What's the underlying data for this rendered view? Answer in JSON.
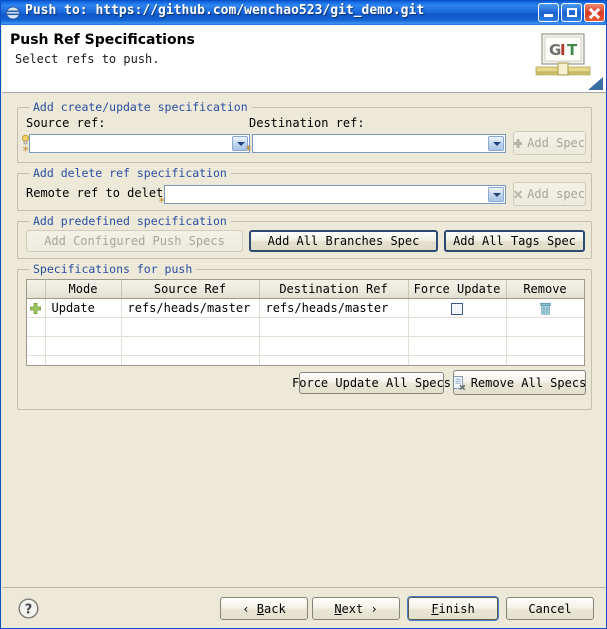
{
  "window": {
    "title": "Push to: https://github.com/wenchao523/git_demo.git",
    "app_icon": "git-window-icon",
    "minimize_label": "Minimize",
    "maximize_label": "Maximize",
    "close_label": "Close"
  },
  "header": {
    "title": "Push Ref Specifications",
    "subtitle": "Select refs to push.",
    "logo_text": "GIT",
    "logo_letters": [
      "G",
      "I",
      "T"
    ]
  },
  "create_update_group": {
    "legend": "Add create/update specification",
    "source_label": "Source ref:",
    "source_value": "",
    "source_decoration": "*",
    "source_hint_icon": "lightbulb-icon",
    "destination_label": "Destination ref:",
    "destination_value": "",
    "destination_decoration": "*",
    "add_spec_label": "Add Spec",
    "add_spec_icon": "plus-icon",
    "add_spec_enabled": false
  },
  "delete_group": {
    "legend": "Add delete ref specification",
    "remote_label": "Remote ref to delete:",
    "remote_value": "",
    "remote_decoration": "*",
    "add_spec_label": "Add spec",
    "add_spec_icon": "x-mark-icon",
    "add_spec_enabled": false
  },
  "predefined_group": {
    "legend": "Add predefined specification",
    "add_configured_label": "Add Configured Push Specs",
    "add_configured_enabled": false,
    "add_all_branches_label": "Add All Branches Spec",
    "add_all_tags_label": "Add All Tags Spec"
  },
  "specs_group": {
    "legend": "Specifications for push",
    "columns": [
      "",
      "Mode",
      "Source Ref",
      "Destination Ref",
      "Force Update",
      "Remove"
    ],
    "rows": [
      {
        "icon": "plus-icon",
        "mode": "Update",
        "source_ref": "refs/heads/master",
        "destination_ref": "refs/heads/master",
        "force_update": false,
        "remove_icon": "trash-icon"
      }
    ],
    "empty_row_count": 8,
    "force_update_all_label": "Force Update All Specs",
    "remove_all_label": "Remove All Specs",
    "remove_all_icon": "remove-all-icon"
  },
  "footer": {
    "help_icon": "help-question-icon",
    "buttons": [
      {
        "name": "back",
        "prefix": "‹ ",
        "pre": "",
        "mnemonic": "B",
        "post": "ack",
        "suffix": "",
        "default": false,
        "enabled": true
      },
      {
        "name": "next",
        "prefix": "",
        "pre": "",
        "mnemonic": "N",
        "post": "ext",
        "suffix": " ›",
        "default": false,
        "enabled": true
      },
      {
        "name": "finish",
        "prefix": "",
        "pre": "",
        "mnemonic": "F",
        "post": "inish",
        "suffix": "",
        "default": true,
        "enabled": true
      },
      {
        "name": "cancel",
        "prefix": "",
        "pre": "",
        "mnemonic": "",
        "post": "Cancel",
        "suffix": "",
        "default": false,
        "enabled": true
      }
    ]
  },
  "colors": {
    "dialog_background": "#ece9d8",
    "title_bar_blue": "#1a6ad8",
    "group_legend_blue": "#2b4ea2",
    "table_background": "#ffffff",
    "decoration_orange": "#c08a28",
    "close_button_red": "#d63b20"
  }
}
